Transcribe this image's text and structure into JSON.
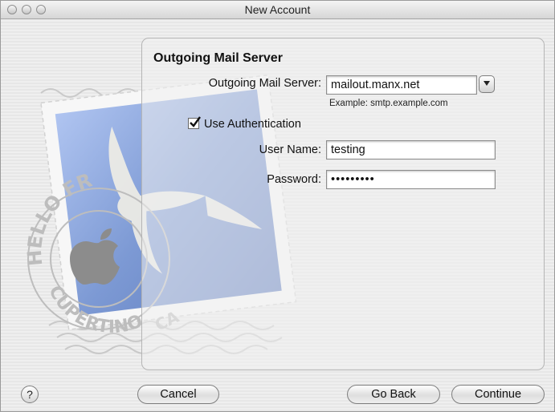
{
  "window": {
    "title": "New Account"
  },
  "panel": {
    "heading": "Outgoing Mail Server",
    "server_label": "Outgoing Mail Server:",
    "server_value": "mailout.manx.net",
    "server_example": "Example: smtp.example.com",
    "use_auth_label": "Use Authentication",
    "use_auth_checked": true,
    "user_name_label": "User Name:",
    "user_name_value": "testing",
    "password_label": "Password:",
    "password_value": "•••••••••"
  },
  "stamp": {
    "top_text": "HELLO FR",
    "bottom_text": "CUPERTINO",
    "suffix_text": "CA"
  },
  "buttons": {
    "help": "?",
    "cancel": "Cancel",
    "go_back": "Go Back",
    "continue": "Continue"
  },
  "colors": {
    "stamp_blue": "#6f8fd0",
    "window_bg": "#ececec"
  }
}
